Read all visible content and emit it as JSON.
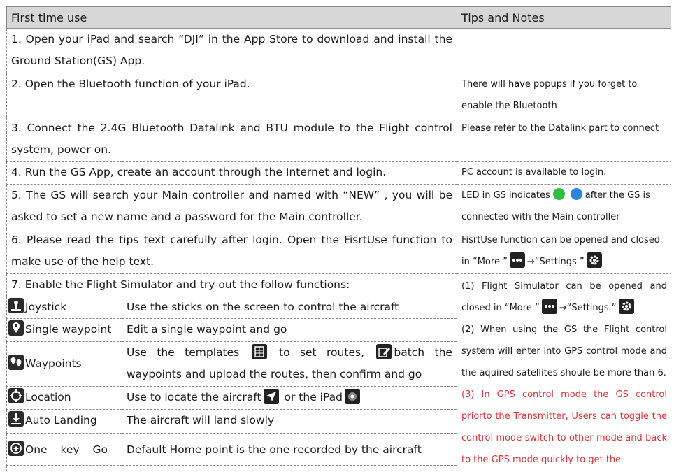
{
  "header": {
    "col1": "First time use",
    "col2": "Tips and Notes"
  },
  "rows": [
    {
      "main": "1. Open your iPad and search “DJI” in the App Store to download and install the Ground Station(GS) App.",
      "tip": ""
    },
    {
      "main": "2. Open the Bluetooth function of your iPad.",
      "tip": "There will have popups if you forget to enable the Bluetooth"
    },
    {
      "main": "3. Connect the 2.4G Bluetooth Datalink and BTU module to the Flight control system, power on.",
      "tip": "Please refer to the Datalink part to connect"
    },
    {
      "main": "4. Run the GS App, create an account through the Internet and login.",
      "tip": "PC account is available to login."
    },
    {
      "main": "5. The GS will search your Main controller and named with “NEW” , you will be asked to set a new name and a password for the Main controller.",
      "tip_a": "LED in GS indicates",
      "tip_b": "after the GS is connected with the Main controller"
    },
    {
      "main": "6. Please read the tips text carefully after login. Open the FisrtUse function to make use of the help text.",
      "tip_a": "FisrtUse function can be opened and closed in  “More  ”",
      "tip_b": "→“Settings  ”"
    }
  ],
  "row7": {
    "main": "7. Enable the Flight Simulator and try out the follow functions:",
    "tip1_a": "(1) Flight Simulator can be opened and closed in  “More  ”",
    "tip1_b": "→“Settings  ”",
    "tip2": "(2) When using the GS the Flight control system will enter into GPS control mode and the aquired satellites shoule be more than 6.",
    "tip3": "(3) In GPS control mode the GS control priorto the Transmitter, Users can toggle the control mode switch to other mode and back to the GPS mode quickly to get the"
  },
  "functions": [
    {
      "name": "Joystick",
      "desc": "Use the sticks on the screen to control the aircraft"
    },
    {
      "name": "Single waypoint",
      "desc": "Edit a single waypoint and go"
    },
    {
      "name": "Waypoints",
      "desc_a": "Use the templates",
      "desc_b": "to set routes,",
      "desc_c": "batch the waypoints and upload the routes, then confirm and go"
    },
    {
      "name": "Location",
      "desc_a": "Use to locate the aircraft",
      "desc_b": "or the iPad"
    },
    {
      "name": "Auto Landing",
      "desc": "The aircraft will land slowly"
    },
    {
      "name": "One key Go",
      "desc": "Default Home point is the one recorded by the aircraft"
    }
  ],
  "colors": {
    "header_bg": "#d7d7d7",
    "led_green": "#2fbf3f",
    "led_blue": "#2a86d8",
    "warning_red": "#d8333a"
  },
  "icons": [
    "joystick-icon",
    "single-waypoint-icon",
    "waypoints-icon",
    "location-icon",
    "auto-landing-icon",
    "one-key-go-icon",
    "more-icon",
    "settings-icon",
    "templates-icon",
    "batch-edit-icon",
    "locate-aircraft-icon",
    "locate-ipad-icon"
  ]
}
